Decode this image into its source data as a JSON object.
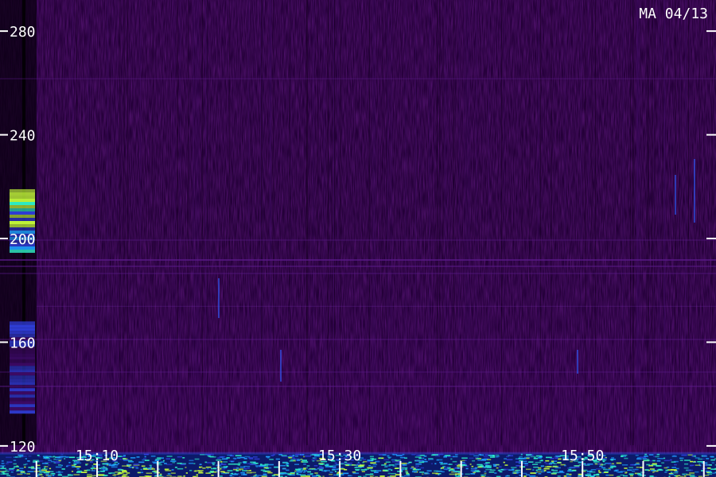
{
  "chart_data": {
    "type": "heatmap",
    "title": "MA 04/13",
    "xlabel": "",
    "ylabel": "",
    "y_ticks": [
      120,
      160,
      200,
      240,
      280
    ],
    "y_range": [
      108,
      292
    ],
    "x_ticks": [
      "15:10",
      "15:30",
      "15:50"
    ],
    "x_range_minutes": [
      "15:02",
      "16:01"
    ],
    "grid": false,
    "colormap": [
      "#000000",
      "#2a0044",
      "#3d0a66",
      "#2f3dd6",
      "#1fa0ff",
      "#2ff2c8",
      "#c8ff3a"
    ],
    "features": [
      {
        "name": "",
        "time": "15:02",
        "y_range": [
          195,
          219
        ],
        "intensity": "high"
      },
      {
        "name": "",
        "time": "15:02",
        "y_range": [
          132,
          168
        ],
        "intensity": "medium"
      },
      {
        "name": "",
        "time_range": [
          "15:02",
          "16:01"
        ],
        "y_range": [
          108,
          117
        ],
        "intensity": "high"
      },
      {
        "name": "",
        "time_range": [
          "15:02",
          "16:01"
        ],
        "y": 174,
        "intensity": "low"
      }
    ]
  }
}
